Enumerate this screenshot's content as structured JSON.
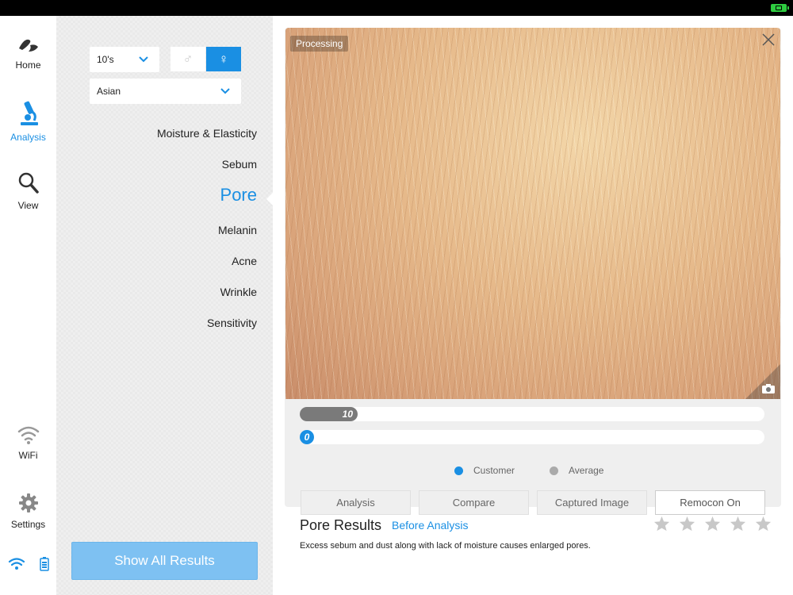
{
  "nav": {
    "home_label": "Home",
    "analysis_label": "Analysis",
    "view_label": "View",
    "wifi_label": "WiFi",
    "settings_label": "Settings",
    "accent_color": "#1a8fe3"
  },
  "filters": {
    "age_value": "10's",
    "ethnicity_value": "Asian",
    "gender_male_symbol": "♂",
    "gender_female_symbol": "♀",
    "gender_selected": "female"
  },
  "categories": [
    {
      "label": "Moisture & Elasticity",
      "active": false
    },
    {
      "label": "Sebum",
      "active": false
    },
    {
      "label": "Pore",
      "active": true
    },
    {
      "label": "Melanin",
      "active": false
    },
    {
      "label": "Acne",
      "active": false
    },
    {
      "label": "Wrinkle",
      "active": false
    },
    {
      "label": "Sensitivity",
      "active": false
    }
  ],
  "show_all_label": "Show All Results",
  "image": {
    "processing_label": "Processing"
  },
  "bars": {
    "average_value": "10",
    "average_fraction": 0.125,
    "customer_value": "0",
    "customer_fraction": 0.0
  },
  "legend": {
    "customer_label": "Customer",
    "customer_color": "#1a8fe3",
    "average_label": "Average",
    "average_color": "#aaaaaa"
  },
  "buttons": {
    "analysis": "Analysis",
    "compare": "Compare",
    "captured_image": "Captured Image",
    "remocon": "Remocon On"
  },
  "results": {
    "title": "Pore Results",
    "subtitle": "Before Analysis",
    "description": "Excess sebum and dust along with lack of moisture causes enlarged pores.",
    "stars_total": 5,
    "stars_filled": 0
  }
}
